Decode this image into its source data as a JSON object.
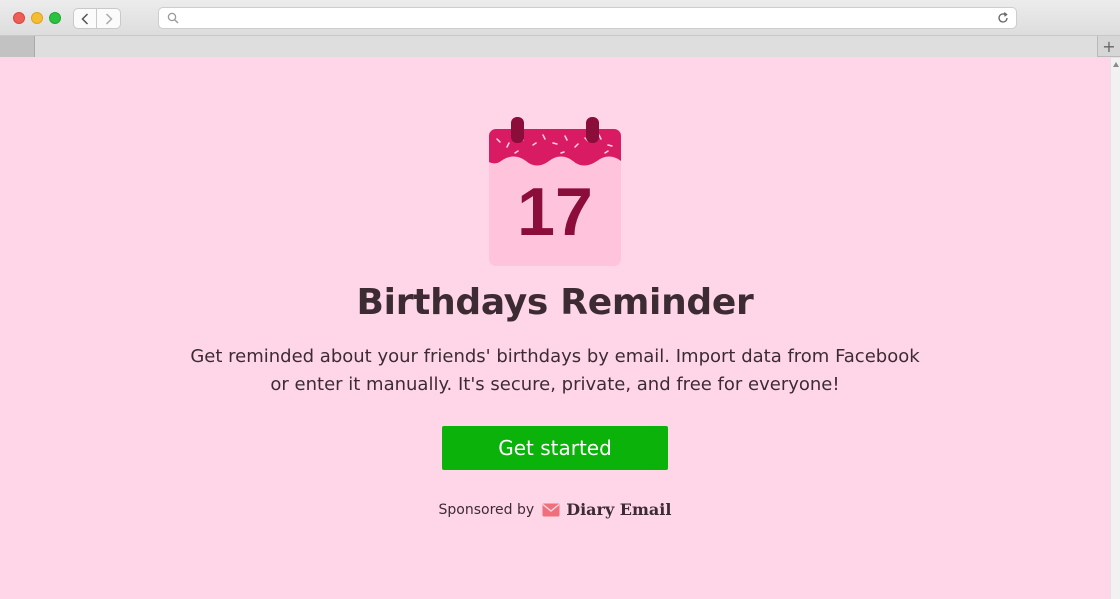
{
  "browser": {
    "url_text": "",
    "new_tab_label": "+"
  },
  "page": {
    "calendar_day": "17",
    "title": "Birthdays Reminder",
    "description": "Get reminded about your friends' birthdays by email. Import data from Facebook or enter it manually. It's secure, private, and free for everyone!",
    "cta_label": "Get started",
    "sponsored_by_label": "Sponsored by",
    "sponsor_name": "Diary Email"
  },
  "colors": {
    "page_background": "#ffd6e8",
    "cta_background": "#0ab20a",
    "calendar_header": "#d81b63",
    "calendar_body": "#ffc3dc",
    "calendar_ring": "#8b0d3a",
    "calendar_number": "#8b0d3a",
    "text": "#3d2b33"
  },
  "icons": {
    "search": "search-icon",
    "reload": "reload-icon",
    "back": "chevron-left-icon",
    "forward": "chevron-right-icon",
    "calendar": "calendar-icon",
    "envelope": "envelope-icon"
  }
}
